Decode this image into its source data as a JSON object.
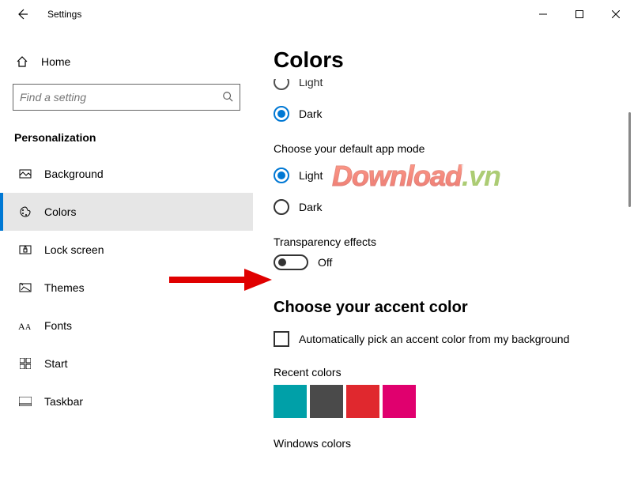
{
  "titlebar": {
    "app_name": "Settings"
  },
  "sidebar": {
    "home_label": "Home",
    "search_placeholder": "Find a setting",
    "category": "Personalization",
    "items": [
      {
        "label": "Background"
      },
      {
        "label": "Colors"
      },
      {
        "label": "Lock screen"
      },
      {
        "label": "Themes"
      },
      {
        "label": "Fonts"
      },
      {
        "label": "Start"
      },
      {
        "label": "Taskbar"
      }
    ]
  },
  "content": {
    "page_title": "Colors",
    "win_mode": {
      "light": "Light",
      "dark": "Dark",
      "selected": "Dark"
    },
    "app_mode_heading": "Choose your default app mode",
    "app_mode": {
      "light": "Light",
      "dark": "Dark",
      "selected": "Light"
    },
    "transparency_label": "Transparency effects",
    "transparency_state": "Off",
    "accent_heading": "Choose your accent color",
    "auto_accent_label": "Automatically pick an accent color from my background",
    "recent_label": "Recent colors",
    "recent_colors": [
      "#00a0a8",
      "#4a4a4a",
      "#e0282e",
      "#e0006e"
    ],
    "windows_colors_label": "Windows colors"
  },
  "watermark": {
    "main": "Download",
    "suffix": ".vn"
  }
}
